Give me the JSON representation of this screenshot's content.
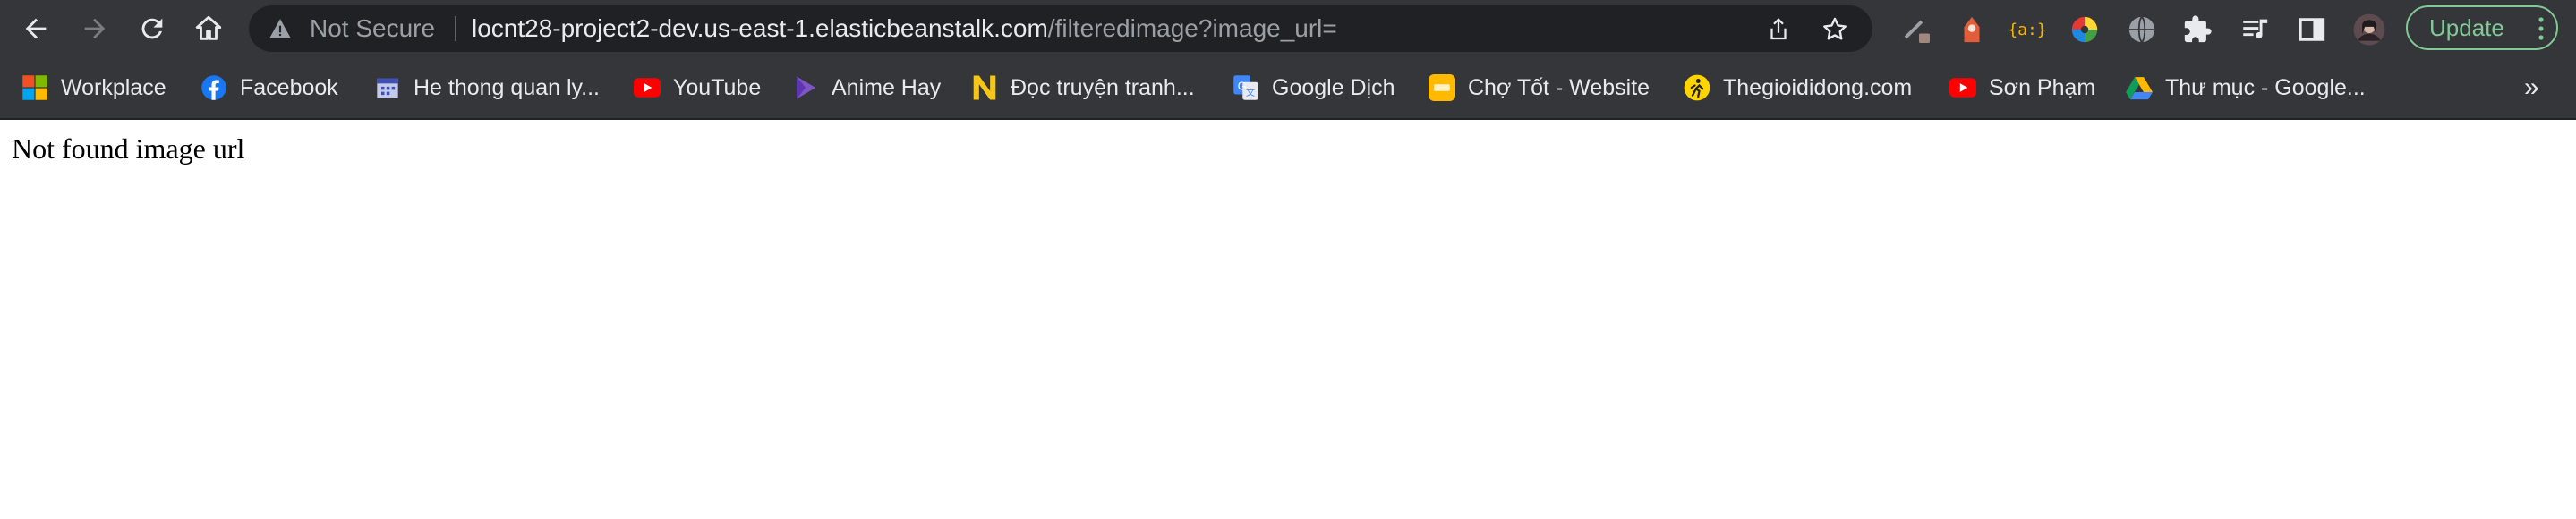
{
  "browser": {
    "address_bar": {
      "security_label": "Not Secure",
      "url_host": "locnt28-project2-dev.us-east-1.elasticbeanstalk.com",
      "url_path": "/filteredimage?image_url="
    },
    "update_label": "Update",
    "extensions": [
      "tools-icon",
      "fox-icon",
      "json-icon",
      "color-wheel-icon",
      "globe-icon",
      "puzzle-icon",
      "media-icon",
      "side-panel-icon",
      "profile-avatar"
    ],
    "bookmarks": [
      {
        "label": "Workplace",
        "icon": "microsoft-icon"
      },
      {
        "label": "Facebook",
        "icon": "facebook-icon"
      },
      {
        "label": "He thong quan ly...",
        "icon": "calendar-icon"
      },
      {
        "label": "YouTube",
        "icon": "youtube-icon"
      },
      {
        "label": "Anime Hay",
        "icon": "play-icon"
      },
      {
        "label": "Đọc truyện tranh...",
        "icon": "n-logo-icon"
      },
      {
        "label": "Google Dịch",
        "icon": "google-translate-icon"
      },
      {
        "label": "Chợ Tốt - Website",
        "icon": "chotot-icon"
      },
      {
        "label": "Thegioididong.com",
        "icon": "tgdd-icon"
      },
      {
        "label": "Sơn Phạm",
        "icon": "youtube-icon"
      },
      {
        "label": "Thư mục - Google...",
        "icon": "google-drive-icon"
      }
    ],
    "overflow_label": "»"
  },
  "page": {
    "message": "Not found image url"
  }
}
